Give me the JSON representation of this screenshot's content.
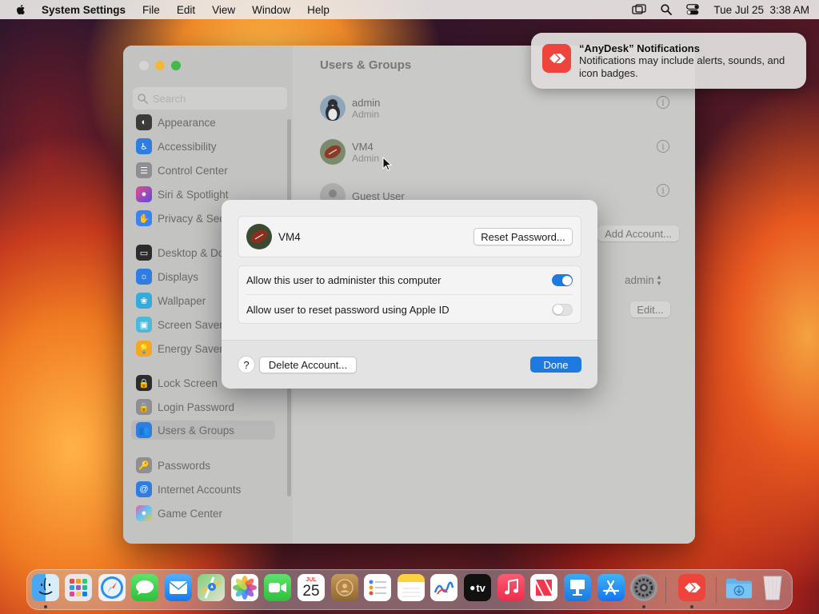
{
  "menubar": {
    "app_name": "System Settings",
    "menus": [
      "File",
      "Edit",
      "View",
      "Window",
      "Help"
    ],
    "datetime": "Tue Jul 25  3:38 AM",
    "status_icons": [
      "screen-mirroring-icon",
      "search-icon",
      "control-center-icon"
    ]
  },
  "notification": {
    "title": "“AnyDesk” Notifications",
    "body": "Notifications may include alerts, sounds, and icon badges.",
    "icon": "anydesk-icon",
    "accent": "#ef443b"
  },
  "settings": {
    "search_placeholder": "Search",
    "title": "Users & Groups",
    "sidebar": [
      {
        "label": "Appearance",
        "icon": "appearance-icon",
        "color": "#3b3b3b"
      },
      {
        "label": "Accessibility",
        "icon": "accessibility-icon",
        "color": "#2f7de1"
      },
      {
        "label": "Control Center",
        "icon": "control-center-icon",
        "color": "#8e8e93"
      },
      {
        "label": "Siri & Spotlight",
        "icon": "siri-icon",
        "color": "#b44ad6"
      },
      {
        "label": "Privacy & Sec",
        "icon": "privacy-hand-icon",
        "color": "#3a82f7"
      },
      {
        "label": "Desktop & Do",
        "icon": "desktop-dock-icon",
        "color": "#2c2c2e"
      },
      {
        "label": "Displays",
        "icon": "displays-icon",
        "color": "#2f7de1"
      },
      {
        "label": "Wallpaper",
        "icon": "wallpaper-icon",
        "color": "#35aadc"
      },
      {
        "label": "Screen Saver",
        "icon": "screen-saver-icon",
        "color": "#4fb8d8"
      },
      {
        "label": "Energy Saver",
        "icon": "energy-saver-icon",
        "color": "#f5a623"
      },
      {
        "label": "Lock Screen",
        "icon": "lock-screen-icon",
        "color": "#2c2c2e"
      },
      {
        "label": "Login Password",
        "icon": "login-password-icon",
        "color": "#8e8e93"
      },
      {
        "label": "Users & Groups",
        "icon": "users-groups-icon",
        "color": "#2f7de1",
        "selected": true
      },
      {
        "label": "Passwords",
        "icon": "passwords-key-icon",
        "color": "#8e8e93"
      },
      {
        "label": "Internet Accounts",
        "icon": "internet-accounts-icon",
        "color": "#2f7de1"
      },
      {
        "label": "Game Center",
        "icon": "game-center-icon",
        "color": "#e94b8a"
      }
    ],
    "users": [
      {
        "name": "admin",
        "role": "Admin",
        "avatar": "penguin-avatar"
      },
      {
        "name": "VM4",
        "role": "Admin",
        "avatar": "football-avatar"
      },
      {
        "name": "Guest User",
        "role": "",
        "avatar": "guest-avatar"
      }
    ],
    "add_account_label": "Add Account...",
    "auto_login_value": "admin",
    "edit_label": "Edit...",
    "help_label": "?"
  },
  "dialog": {
    "user_name": "VM4",
    "reset_password_label": "Reset Password...",
    "options": [
      {
        "label": "Allow this user to administer this computer",
        "on": true
      },
      {
        "label": "Allow user to reset password using Apple ID",
        "on": false
      }
    ],
    "help_label": "?",
    "delete_label": "Delete Account...",
    "done_label": "Done",
    "accent": "#1f7ae0"
  },
  "dock": {
    "apps": [
      {
        "name": "Finder",
        "icon": "finder-icon",
        "running": true
      },
      {
        "name": "Launchpad",
        "icon": "launchpad-icon"
      },
      {
        "name": "Safari",
        "icon": "safari-icon"
      },
      {
        "name": "Messages",
        "icon": "messages-icon"
      },
      {
        "name": "Mail",
        "icon": "mail-icon"
      },
      {
        "name": "Maps",
        "icon": "maps-icon"
      },
      {
        "name": "Photos",
        "icon": "photos-icon"
      },
      {
        "name": "FaceTime",
        "icon": "facetime-icon"
      },
      {
        "name": "Calendar",
        "icon": "calendar-icon",
        "month": "JUL",
        "day": "25"
      },
      {
        "name": "Contacts",
        "icon": "contacts-icon"
      },
      {
        "name": "Reminders",
        "icon": "reminders-icon"
      },
      {
        "name": "Notes",
        "icon": "notes-icon"
      },
      {
        "name": "Freeform",
        "icon": "freeform-icon"
      },
      {
        "name": "TV",
        "icon": "apple-tv-icon",
        "label": "tv"
      },
      {
        "name": "Music",
        "icon": "music-icon"
      },
      {
        "name": "News",
        "icon": "news-icon"
      },
      {
        "name": "Keynote",
        "icon": "keynote-icon"
      },
      {
        "name": "App Store",
        "icon": "app-store-icon"
      },
      {
        "name": "System Settings",
        "icon": "system-settings-icon",
        "running": true
      },
      {
        "name": "AnyDesk",
        "icon": "anydesk-icon",
        "running": true
      },
      {
        "name": "Downloads",
        "icon": "downloads-folder-icon"
      },
      {
        "name": "Trash",
        "icon": "trash-icon"
      }
    ]
  }
}
